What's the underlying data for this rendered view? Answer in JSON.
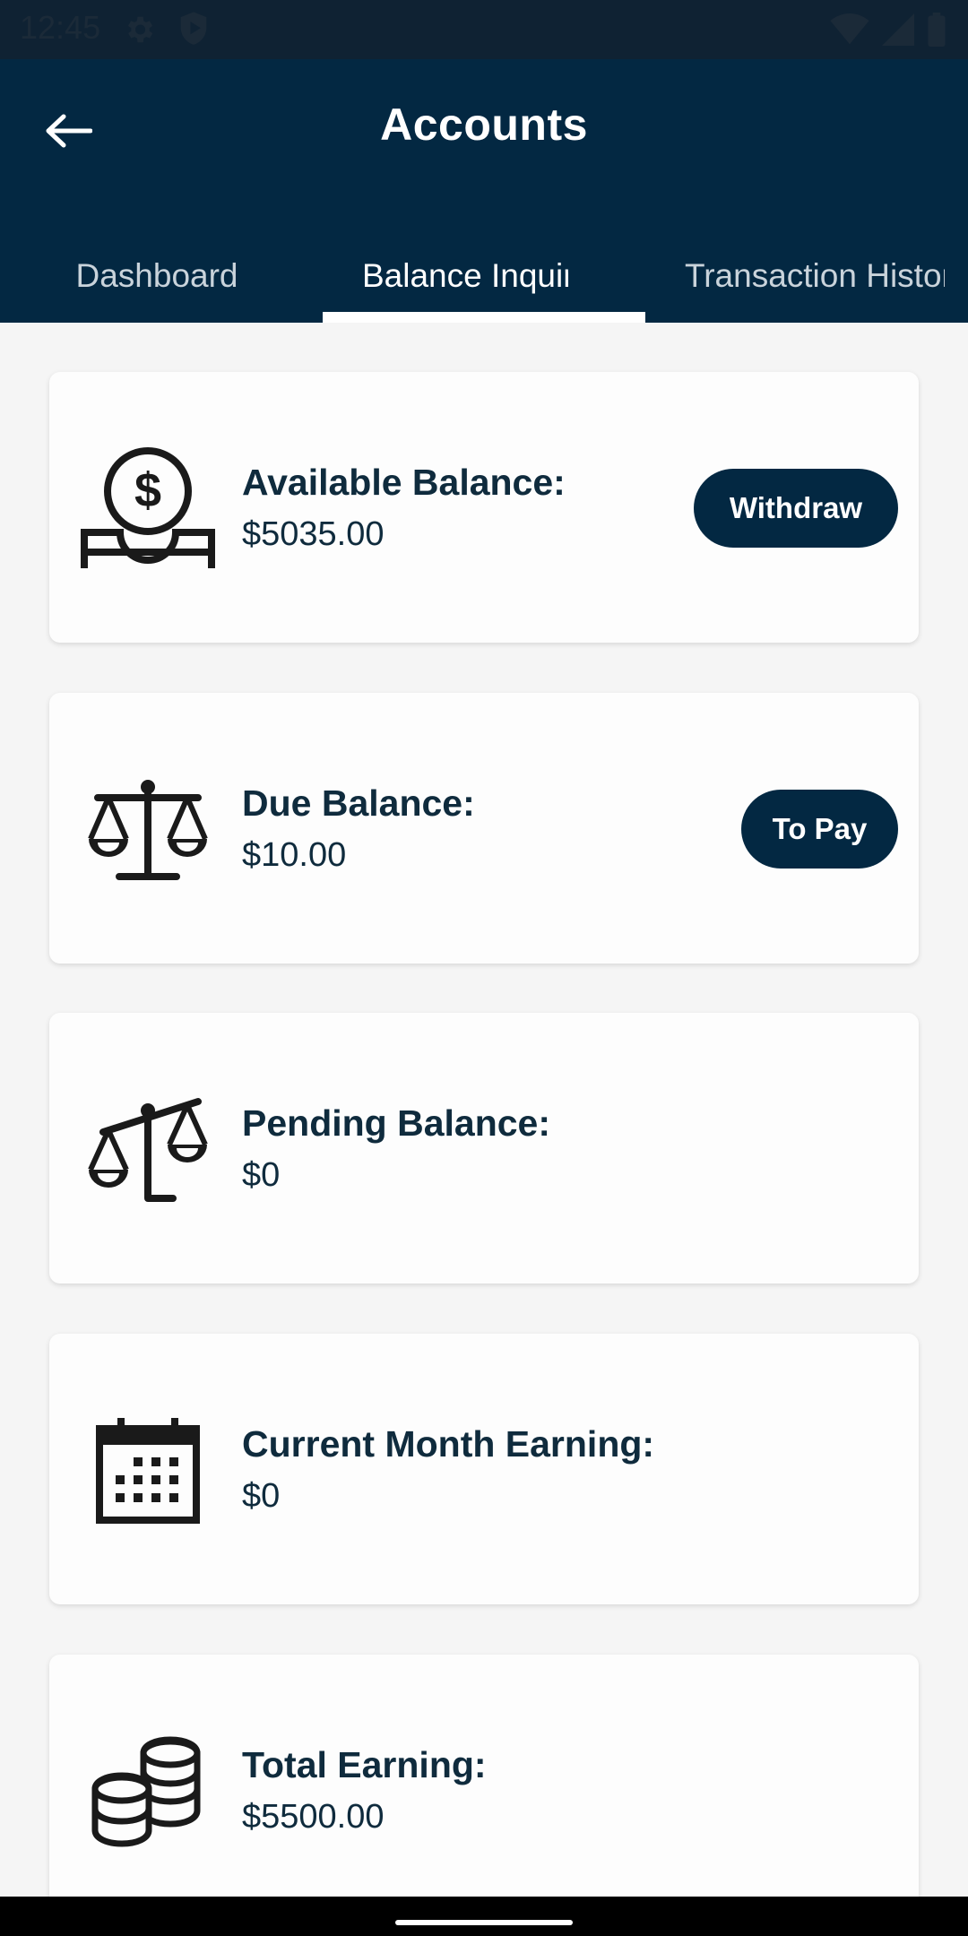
{
  "status_bar": {
    "time": "12:45",
    "icons": [
      "gear-icon",
      "shield-play-icon",
      "wifi-icon",
      "signal-icon",
      "battery-icon"
    ]
  },
  "app_bar": {
    "title": "Accounts",
    "back_icon": "arrow-left-icon",
    "background": "#032842"
  },
  "tabs": [
    {
      "label": "Dashboard",
      "selected": false
    },
    {
      "label": "Balance Inquiry",
      "selected": true
    },
    {
      "label": "Transaction History",
      "selected": false
    }
  ],
  "cards": [
    {
      "label": "Available Balance:",
      "value": "$5035.00",
      "icon": "money-hand-icon",
      "button": "Withdraw"
    },
    {
      "label": "Due Balance:",
      "value": "$10.00",
      "icon": "balanced-scale-icon",
      "button": "To Pay"
    },
    {
      "label": "Pending Balance:",
      "value": "$0",
      "icon": "tilted-scale-icon"
    },
    {
      "label": "Current Month Earning:",
      "value": "$0",
      "icon": "calendar-icon"
    },
    {
      "label": "Total Earning:",
      "value": "$5500.00",
      "icon": "coins-stack-icon"
    }
  ],
  "colors": {
    "primary": "#032842",
    "status_bar": "#0f2233",
    "card_text": "#0f2b3d",
    "background": "#f5f5f5"
  }
}
